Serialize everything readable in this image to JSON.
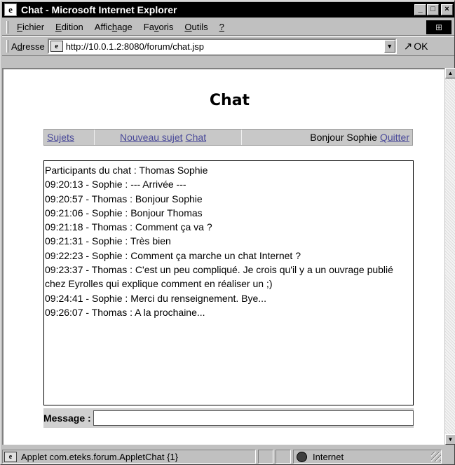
{
  "window": {
    "title": "Chat - Microsoft Internet Explorer",
    "minimize": "_",
    "maximize": "□",
    "close": "×"
  },
  "menu": {
    "items": [
      {
        "pre": "",
        "key": "F",
        "post": "ichier"
      },
      {
        "pre": "",
        "key": "E",
        "post": "dition"
      },
      {
        "pre": "Affic",
        "key": "h",
        "post": "age"
      },
      {
        "pre": "Fa",
        "key": "v",
        "post": "oris"
      },
      {
        "pre": "",
        "key": "O",
        "post": "utils"
      },
      {
        "pre": "",
        "key": "?",
        "post": ""
      }
    ]
  },
  "address": {
    "label_pre": "A",
    "label_key": "d",
    "label_post": "resse",
    "url": "http://10.0.1.2:8080/forum/chat.jsp",
    "go_label": "OK"
  },
  "page": {
    "title": "Chat",
    "nav": {
      "subjects": "Sujets",
      "new_subject": "Nouveau sujet",
      "chat": "Chat",
      "greeting": "Bonjour Sophie",
      "quit": "Quitter"
    },
    "chat_lines": [
      "Participants du chat : Thomas Sophie",
      "09:20:13 - Sophie : --- Arrivée ---",
      "09:20:57 - Thomas : Bonjour Sophie",
      "09:21:06 - Sophie : Bonjour Thomas",
      "09:21:18 - Thomas : Comment ça va ?",
      "09:21:31 - Sophie : Très bien",
      "09:22:23 - Sophie : Comment ça marche un chat Internet ?",
      "09:23:37 - Thomas : C'est un peu compliqué. Je crois qu'il y a un ouvrage publié chez Eyrolles qui explique comment en réaliser un ;)",
      "09:24:41 - Sophie : Merci du renseignement. Bye...",
      "09:26:07 - Thomas : A la prochaine..."
    ],
    "message_label": "Message :",
    "message_value": ""
  },
  "status": {
    "text": "Applet com.eteks.forum.AppletChat {1}",
    "zone": "Internet"
  }
}
